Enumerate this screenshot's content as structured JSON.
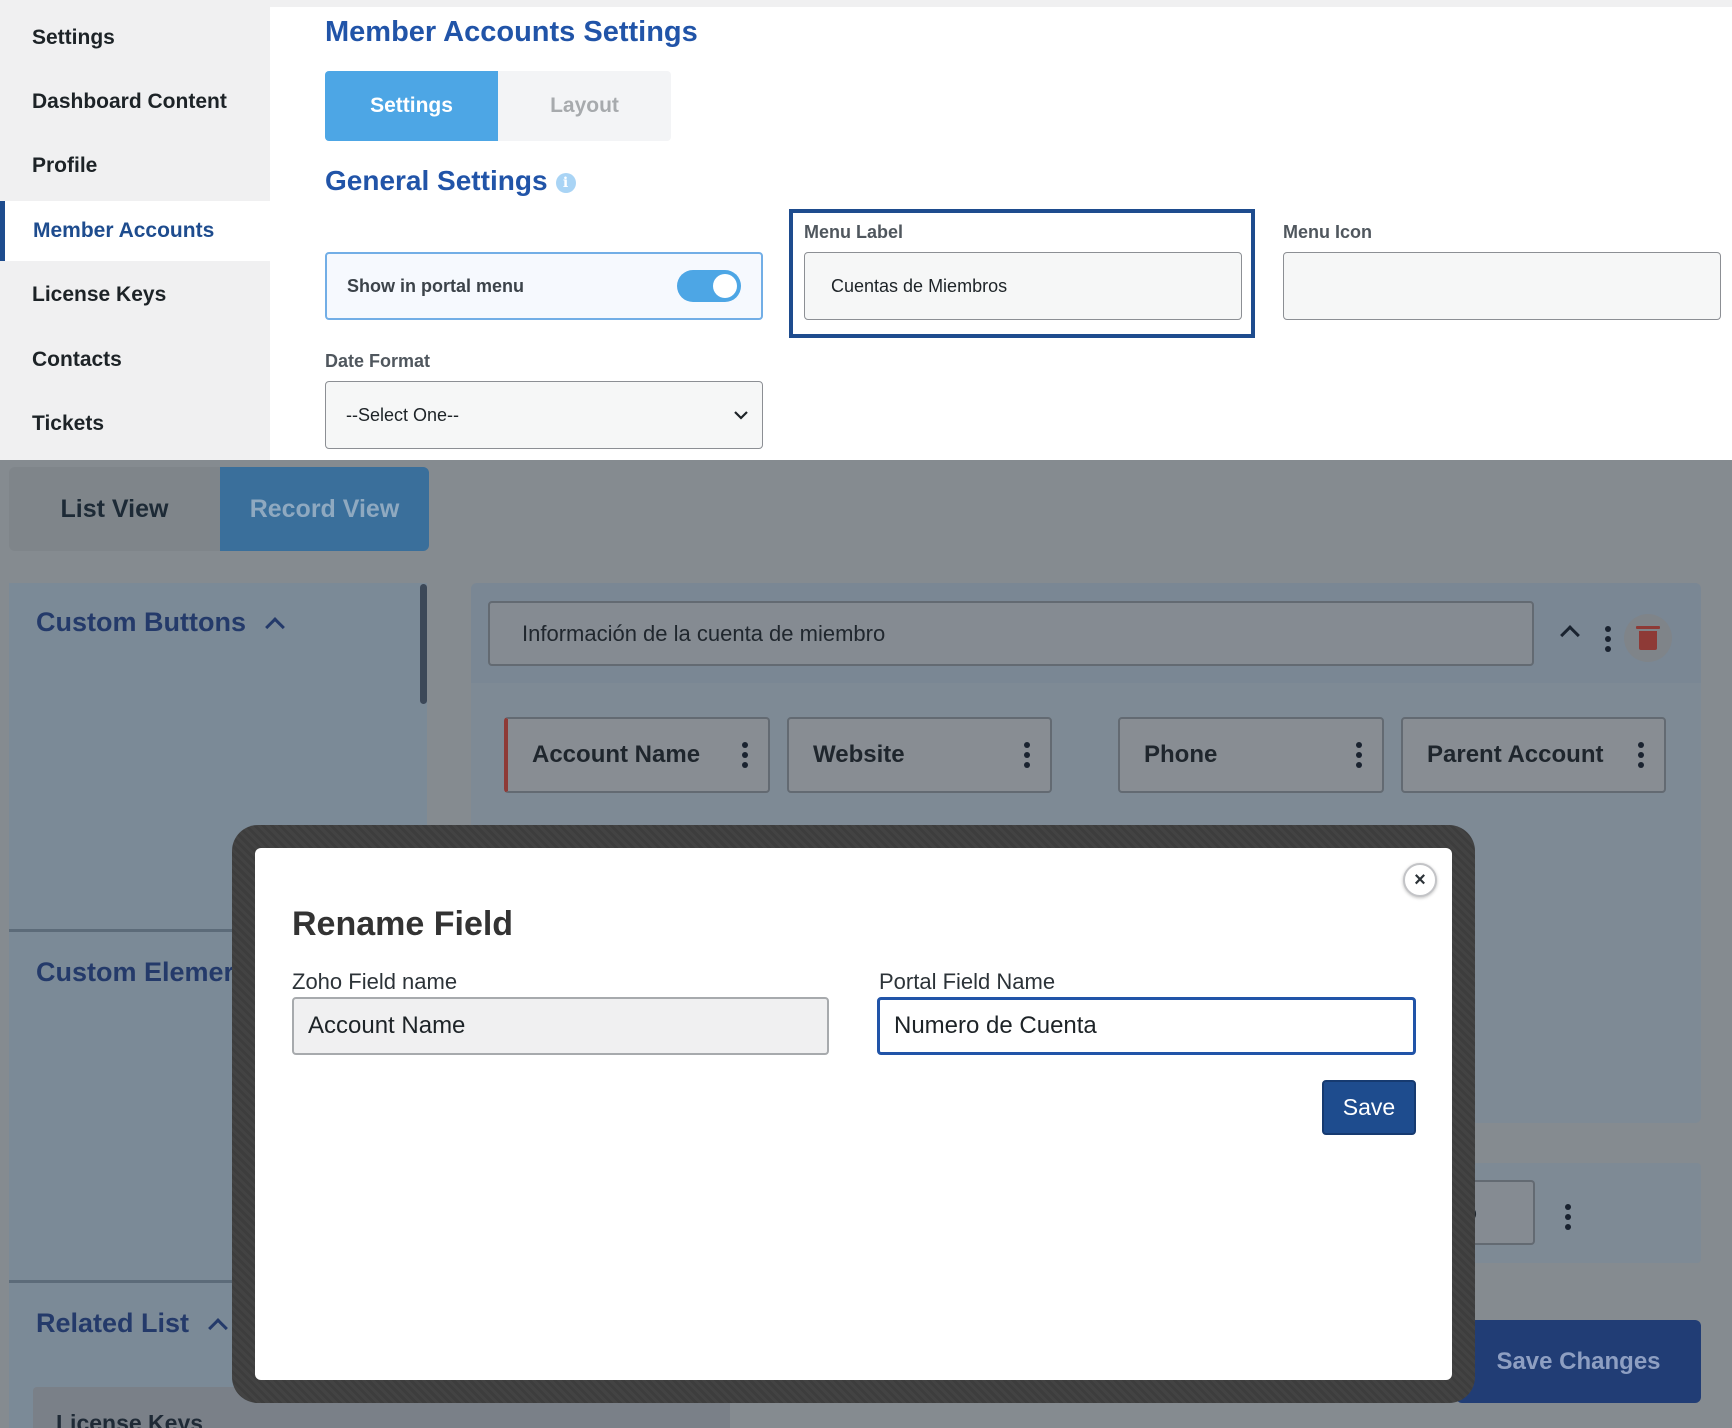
{
  "sidebar": {
    "items": [
      {
        "label": "Settings"
      },
      {
        "label": "Dashboard Content"
      },
      {
        "label": "Profile"
      },
      {
        "label": "Member Accounts",
        "active": true
      },
      {
        "label": "License Keys"
      },
      {
        "label": "Contacts"
      },
      {
        "label": "Tickets"
      }
    ]
  },
  "header": {
    "title": "Member Accounts Settings",
    "tabs": [
      {
        "label": "Settings",
        "active": true
      },
      {
        "label": "Layout"
      }
    ]
  },
  "general": {
    "title": "General Settings",
    "info_icon": "info-icon",
    "show_portal_label": "Show in portal menu",
    "show_portal_enabled": true,
    "menu_label_label": "Menu Label",
    "menu_label_value": "Cuentas de Miembros",
    "menu_icon_label": "Menu Icon",
    "menu_icon_value": "",
    "date_format_label": "Date Format",
    "date_format_value": "--Select One--"
  },
  "layout": {
    "view_tabs": [
      {
        "label": "List View"
      },
      {
        "label": "Record View",
        "active": true
      }
    ],
    "left_sections": [
      {
        "label": "Custom Buttons"
      },
      {
        "label": "Custom Elemer"
      },
      {
        "label": "Related List"
      }
    ],
    "related_first_item": "License Keys",
    "section_name": "Información de la cuenta de miembro",
    "fields": [
      {
        "label": "Account Name"
      },
      {
        "label": "Website"
      },
      {
        "label": "Phone"
      },
      {
        "label": "Parent Account"
      }
    ],
    "partial_field_text": "ho",
    "save_changes_label": "Save Changes"
  },
  "modal": {
    "title": "Rename Field",
    "close_symbol": "×",
    "zoho_label": "Zoho Field name",
    "zoho_value": "Account Name",
    "portal_label": "Portal Field Name",
    "portal_value": "Numero de Cuenta",
    "save_label": "Save"
  },
  "colors": {
    "accent": "#2154a8",
    "tab_active": "#4da6e5",
    "focus_frame": "#1e4c8e",
    "danger": "#8e3a36"
  }
}
